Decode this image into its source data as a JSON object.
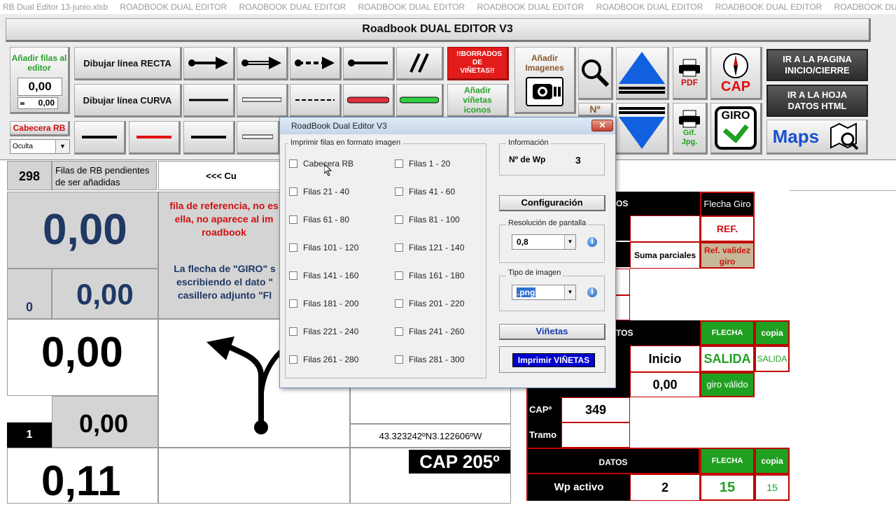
{
  "window": {
    "file_title": "RB Dual Editor 13-junio.xlsb",
    "title_repeat": "ROADBOOK DUAL EDITOR",
    "title_tail": "ROADBOOK DUAL ..."
  },
  "banner": "Roadbook DUAL EDITOR V3",
  "ribbon": {
    "add_rows_label": "Añadir filas al editor",
    "add_rows_value": "0,00",
    "add_rows_small": "0,00",
    "draw_straight": "Dibujar línea RECTA",
    "draw_curve": "Dibujar línea CURVA",
    "delete_icons": "!!BORRADOS DE VIÑETAS!!",
    "add_images": "Añadir Imagenes",
    "add_icons": "Añadir viñetas iconos",
    "no_label": "Nº",
    "pdf": "PDF",
    "cap": "CAP",
    "gif_jpg": "Gif. Jpg.",
    "giro": "GIRO",
    "goto_start": "IR A LA PAGINA INICIO/CIERRE",
    "goto_html": "IR A LA HOJA DATOS HTML",
    "maps": "Maps",
    "header_rb": "Cabecera RB",
    "oculta": "Oculta"
  },
  "sheet": {
    "pending_count": "298",
    "pending_label": "Filas de RB pendientes de ser añadidas",
    "cu_text": "<<< Cu",
    "dist_total": "0,00",
    "dist_partial": "0,00",
    "zero_small": "0",
    "ref_text": "fila de referencia, no es ella, no aparece al im roadbook",
    "giro_text": "La flecha de \"GIRO\" s escribiendo el dato \" casillero adjunto \"Fl",
    "dist2_total": "0,00",
    "dist2_partial": "0,00",
    "row_num": "1",
    "dist3_total": "0,11",
    "coords": "43.323242ºN3.122606ºW",
    "cap_big": "CAP 205º",
    "flecha_giro": "Flecha Giro",
    "os": "OS",
    "ref": "REF.",
    "suma_parciales": "Suma parciales",
    "ref_validez": "Ref. validez giro",
    "tos": "TOS",
    "flecha_giro_caps": "FLECHA GIRO",
    "copia": "copia",
    "inicio": "Inicio",
    "salida": "SALIDA",
    "salida_copy": "SALIDA",
    "parciales_val": "0,00",
    "giro_valido": "giro válido",
    "cap_label": "CAPº",
    "cap_value": "349",
    "tramo": "Tramo",
    "datos": "DATOS",
    "flecha_giro_caps2": "FLECHA GIRO",
    "copia2": "copia",
    "wp_activo": "Wp activo",
    "wp_value": "2",
    "flecha_val": "15",
    "flecha_copy": "15"
  },
  "dialog": {
    "title": "RoadBook Dual Editor V3",
    "close": "✕",
    "print_frame_label": "Imprimir filas en formato imagen",
    "checkboxes_left": [
      "Cabecera RB",
      "Filas 21 - 40",
      "Filas 61 - 80",
      "Filas 101 - 120",
      "Filas 141 - 160",
      "Filas 181 - 200",
      "Filas 221 - 240",
      "Filas 261 - 280"
    ],
    "checkboxes_right": [
      "Filas 1 - 20",
      "Filas 41 - 60",
      "Filas 81 - 100",
      "Filas 121 - 140",
      "Filas 161 - 180",
      "Filas 201 - 220",
      "Filas 241 - 260",
      "Filas 281 - 300"
    ],
    "info_label": "Información",
    "wp_label": "Nº de Wp",
    "wp_value": "3",
    "config_button": "Configuración",
    "resolution_label": "Resolución de pantalla",
    "resolution_value": "0,8",
    "image_type_label": "Tipo de imagen",
    "image_type_value": ".png",
    "vinetas_button": "Viñetas",
    "print_vinetas_button": "Imprimir VIÑETAS"
  },
  "colors": {
    "accent_red": "#c00000",
    "accent_green": "#20a020",
    "dark_blue": "#1f3864",
    "print_button_blue": "#0000cc"
  }
}
